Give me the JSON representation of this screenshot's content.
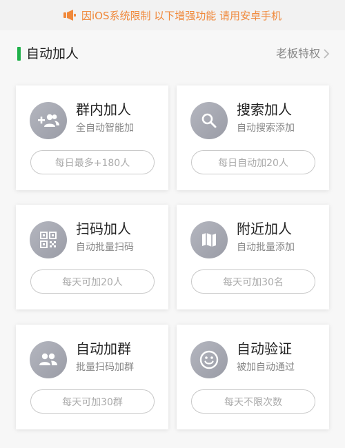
{
  "notice": {
    "text": "因iOS系统限制 以下增强功能 请用安卓手机",
    "color": "#f0883a"
  },
  "section": {
    "title": "自动加人",
    "right_link": "老板特权",
    "accent": "#1fb14a"
  },
  "cards": [
    {
      "title": "群内加人",
      "subtitle": "全自动智能加",
      "pill": "每日最多+180人",
      "icon": "add-group-icon"
    },
    {
      "title": "搜索加人",
      "subtitle": "自动搜索添加",
      "pill": "每日自动加20人",
      "icon": "search-icon"
    },
    {
      "title": "扫码加人",
      "subtitle": "自动批量扫码",
      "pill": "每天可加20人",
      "icon": "qr-code-icon"
    },
    {
      "title": "附近加人",
      "subtitle": "自动批量添加",
      "pill": "每天可加30名",
      "icon": "map-icon"
    },
    {
      "title": "自动加群",
      "subtitle": "批量扫码加群",
      "pill": "每天可加30群",
      "icon": "people-icon"
    },
    {
      "title": "自动验证",
      "subtitle": "被加自动通过",
      "pill": "每天不限次数",
      "icon": "smiley-icon"
    }
  ]
}
